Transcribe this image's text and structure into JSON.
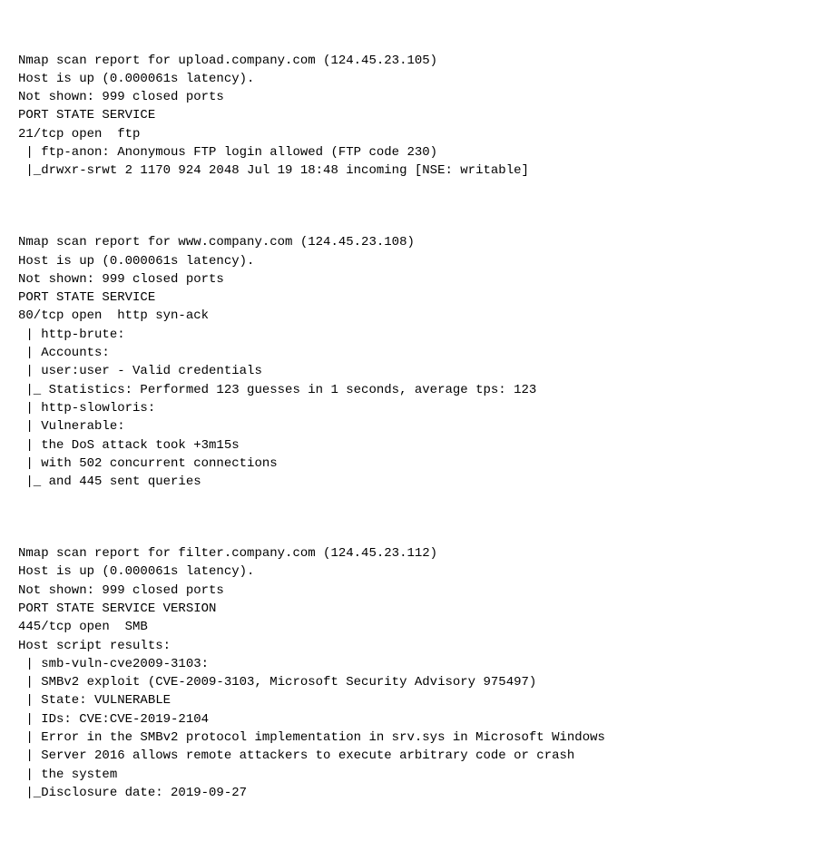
{
  "sections": [
    {
      "id": "section-upload",
      "lines": [
        "Nmap scan report for upload.company.com (124.45.23.105)",
        "Host is up (0.000061s latency).",
        "Not shown: 999 closed ports",
        "PORT STATE SERVICE",
        "21/tcp open  ftp",
        " | ftp-anon: Anonymous FTP login allowed (FTP code 230)",
        " |_drwxr-srwt 2 1170 924 2048 Jul 19 18:48 incoming [NSE: writable]"
      ]
    },
    {
      "id": "section-www",
      "lines": [
        "Nmap scan report for www.company.com (124.45.23.108)",
        "Host is up (0.000061s latency).",
        "Not shown: 999 closed ports",
        "PORT STATE SERVICE",
        "80/tcp open  http syn-ack",
        " | http-brute:",
        " | Accounts:",
        " | user:user - Valid credentials",
        " |_ Statistics: Performed 123 guesses in 1 seconds, average tps: 123",
        " | http-slowloris:",
        " | Vulnerable:",
        " | the DoS attack took +3m15s",
        " | with 502 concurrent connections",
        " |_ and 445 sent queries"
      ]
    },
    {
      "id": "section-filter",
      "lines": [
        "Nmap scan report for filter.company.com (124.45.23.112)",
        "Host is up (0.000061s latency).",
        "Not shown: 999 closed ports",
        "PORT STATE SERVICE VERSION",
        "445/tcp open  SMB",
        "Host script results:",
        " | smb-vuln-cve2009-3103:",
        " | SMBv2 exploit (CVE-2009-3103, Microsoft Security Advisory 975497)",
        " | State: VULNERABLE",
        " | IDs: CVE:CVE-2019-2104",
        " | Error in the SMBv2 protocol implementation in srv.sys in Microsoft Windows",
        " | Server 2016 allows remote attackers to execute arbitrary code or crash",
        " | the system",
        " |_Disclosure date: 2019-09-27"
      ]
    }
  ]
}
